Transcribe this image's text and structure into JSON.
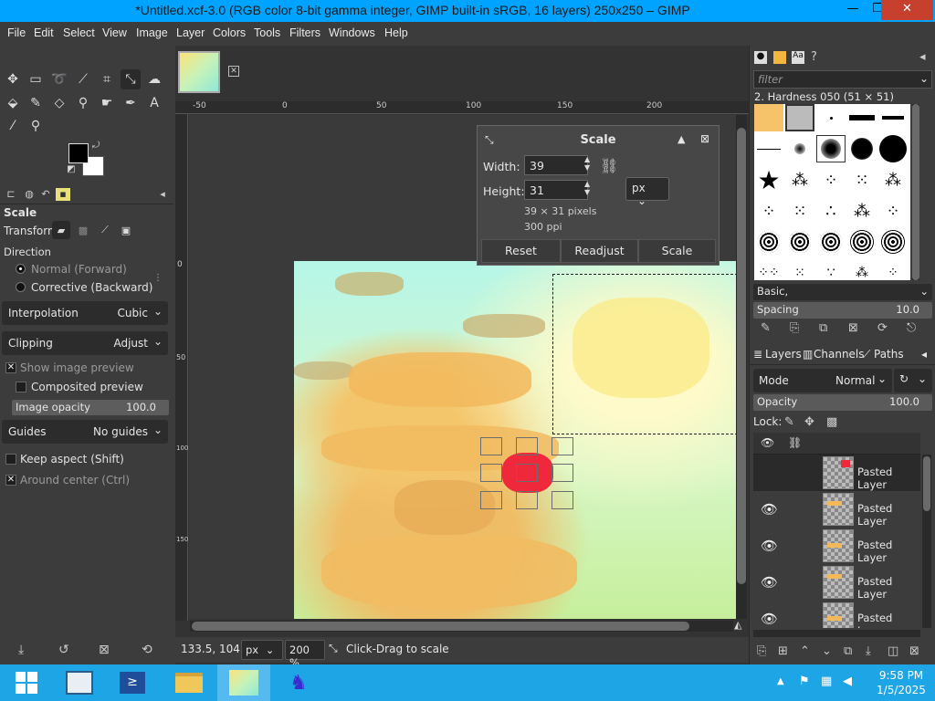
{
  "window": {
    "title": "*Untitled.xcf-3.0 (RGB color 8-bit gamma integer, GIMP built-in sRGB, 16 layers) 250x250 – GIMP",
    "minimize_glyph": "—",
    "maximize_glyph": "❐",
    "close_glyph": "✕"
  },
  "menu": [
    "File",
    "Edit",
    "Select",
    "View",
    "Image",
    "Layer",
    "Colors",
    "Tools",
    "Filters",
    "Windows",
    "Help"
  ],
  "tool_options": {
    "title": "Scale",
    "transform_label": "Transform:",
    "direction_label": "Direction",
    "direction_normal": "Normal (Forward)",
    "direction_corrective": "Corrective (Backward)",
    "interpolation_label": "Interpolation",
    "interpolation_value": "Cubic",
    "clipping_label": "Clipping",
    "clipping_value": "Adjust",
    "show_preview": "Show image preview",
    "composited_preview": "Composited preview",
    "image_opacity_label": "Image opacity",
    "image_opacity_value": "100.0",
    "guides_label": "Guides",
    "guides_value": "No guides",
    "keep_aspect": "Keep aspect (Shift)",
    "around_center": "Around center (Ctrl)"
  },
  "rulers": {
    "h_ticks": [
      "-50",
      "0",
      "50",
      "100",
      "150",
      "200"
    ],
    "v_ticks": [
      "0",
      "50",
      "100",
      "150"
    ]
  },
  "scale_dialog": {
    "title": "Scale",
    "width_label": "Width:",
    "width_value": "39",
    "height_label": "Height:",
    "height_value": "31",
    "size_info": "39 × 31 pixels",
    "resolution_info": "300 ppi",
    "unit": "px",
    "reset": "Reset",
    "readjust": "Readjust",
    "scale": "Scale"
  },
  "status": {
    "coords": "133.5, 104.0",
    "unit": "px",
    "zoom": "200 %",
    "message": "Click-Drag to scale"
  },
  "brushes": {
    "filter_placeholder": "filter",
    "current_brush": "2. Hardness 050 (51 × 51)",
    "tag": "Basic,",
    "spacing_label": "Spacing",
    "spacing_value": "10.0"
  },
  "layers_panel": {
    "tab_layers": "Layers",
    "tab_channels": "Channels",
    "tab_paths": "Paths",
    "mode_label": "Mode",
    "mode_value": "Normal",
    "opacity_label": "Opacity",
    "opacity_value": "100.0",
    "lock_label": "Lock:",
    "layers": [
      {
        "name": "Pasted Layer"
      },
      {
        "name": "Pasted Layer"
      },
      {
        "name": "Pasted Layer"
      },
      {
        "name": "Pasted Layer"
      },
      {
        "name": "Pasted Layer"
      }
    ]
  },
  "taskbar": {
    "time": "9:58 PM",
    "date": "1/5/2025"
  },
  "colors": {
    "titlebar": "#00a3ff",
    "taskbar": "#1ea5e6",
    "panel": "#3c3c3c",
    "close_button": "#c7402e"
  }
}
